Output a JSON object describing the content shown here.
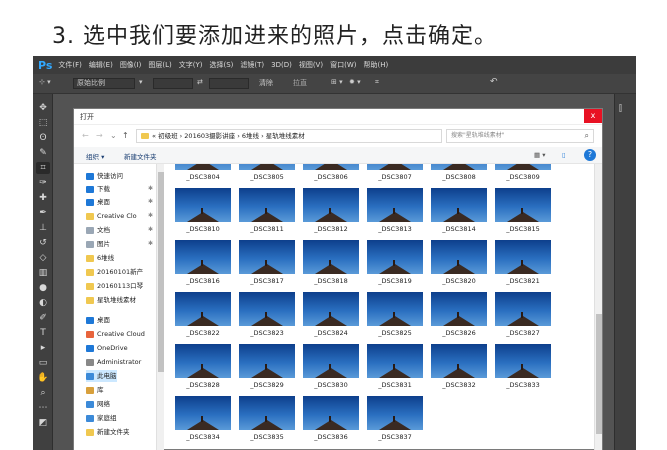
{
  "caption": "3. 选中我们要添加进来的照片，点击确定。",
  "menubar": {
    "logo": "Ps",
    "items": [
      "文件(F)",
      "编辑(E)",
      "图像(I)",
      "图层(L)",
      "文字(Y)",
      "选择(S)",
      "滤镜(T)",
      "3D(D)",
      "视图(V)",
      "窗口(W)",
      "帮助(H)"
    ]
  },
  "options": {
    "style_value": "原始比例",
    "clear_label": "清除",
    "straighten_label": "拉直"
  },
  "dialog": {
    "title": "打开",
    "close_glyph": "x",
    "address": [
      "«",
      "初级班",
      "201603摄影讲座",
      "6堆线",
      "星轨堆线素材"
    ],
    "search_placeholder": "搜索\"星轨堆线素材\"",
    "organize_label": "组织 ▾",
    "new_folder_label": "新建文件夹",
    "help_glyph": "?"
  },
  "nav": {
    "items": [
      {
        "label": "快速访问",
        "icon": "star-icon",
        "color": "#1e78d7"
      },
      {
        "label": "下载",
        "icon": "download-icon",
        "color": "#1e78d7",
        "pinned": true
      },
      {
        "label": "桌面",
        "icon": "desktop-icon",
        "color": "#1e78d7",
        "pinned": true
      },
      {
        "label": "Creative Clo",
        "icon": "folder-icon",
        "color": "#f0c850",
        "pinned": true
      },
      {
        "label": "文档",
        "icon": "document-icon",
        "color": "#9aa7b5",
        "pinned": true
      },
      {
        "label": "图片",
        "icon": "pictures-icon",
        "color": "#9aa7b5",
        "pinned": true
      },
      {
        "label": "6堆线",
        "icon": "folder-icon",
        "color": "#f0c850"
      },
      {
        "label": "20160101新产",
        "icon": "folder-icon",
        "color": "#f0c850"
      },
      {
        "label": "20160113口琴",
        "icon": "folder-icon",
        "color": "#f0c850"
      },
      {
        "label": "星轨堆线素材",
        "icon": "folder-icon",
        "color": "#f0c850"
      },
      {
        "label": "桌面",
        "icon": "desktop-icon",
        "color": "#1e78d7"
      },
      {
        "label": "Creative Cloud",
        "icon": "cloud-icon",
        "color": "#e8643c"
      },
      {
        "label": "OneDrive",
        "icon": "onedrive-icon",
        "color": "#1e78d7"
      },
      {
        "label": "Administrator",
        "icon": "user-icon",
        "color": "#888888"
      },
      {
        "label": "此电脑",
        "icon": "computer-icon",
        "color": "#3c8ad8",
        "selected": true
      },
      {
        "label": "库",
        "icon": "library-icon",
        "color": "#d8a03c"
      },
      {
        "label": "网络",
        "icon": "network-icon",
        "color": "#3c8ad8"
      },
      {
        "label": "家庭组",
        "icon": "homegroup-icon",
        "color": "#3c8ad8"
      },
      {
        "label": "新建文件夹",
        "icon": "folder-icon",
        "color": "#f0c850"
      }
    ]
  },
  "files": {
    "rows": [
      [
        "_DSC3804",
        "_DSC3805",
        "_DSC3806",
        "_DSC3807",
        "_DSC3808",
        "_DSC3809"
      ],
      [
        "_DSC3810",
        "_DSC3811",
        "_DSC3812",
        "_DSC3813",
        "_DSC3814",
        "_DSC3815"
      ],
      [
        "_DSC3816",
        "_DSC3817",
        "_DSC3818",
        "_DSC3819",
        "_DSC3820",
        "_DSC3821"
      ],
      [
        "_DSC3822",
        "_DSC3823",
        "_DSC3824",
        "_DSC3825",
        "_DSC3826",
        "_DSC3827"
      ],
      [
        "_DSC3828",
        "_DSC3829",
        "_DSC3830",
        "_DSC3831",
        "_DSC3832",
        "_DSC3833"
      ],
      [
        "_DSC3834",
        "_DSC3835",
        "_DSC3836",
        "_DSC3837"
      ]
    ]
  },
  "toolbar_icons": [
    "move-icon",
    "marquee-icon",
    "lasso-icon",
    "quick-select-icon",
    "crop-icon",
    "eyedropper-icon",
    "healing-icon",
    "brush-icon",
    "stamp-icon",
    "history-brush-icon",
    "eraser-icon",
    "gradient-icon",
    "blur-icon",
    "dodge-icon",
    "pen-icon",
    "type-icon",
    "path-select-icon",
    "shape-icon",
    "hand-icon",
    "zoom-icon",
    "more-icon",
    "colors-icon"
  ]
}
